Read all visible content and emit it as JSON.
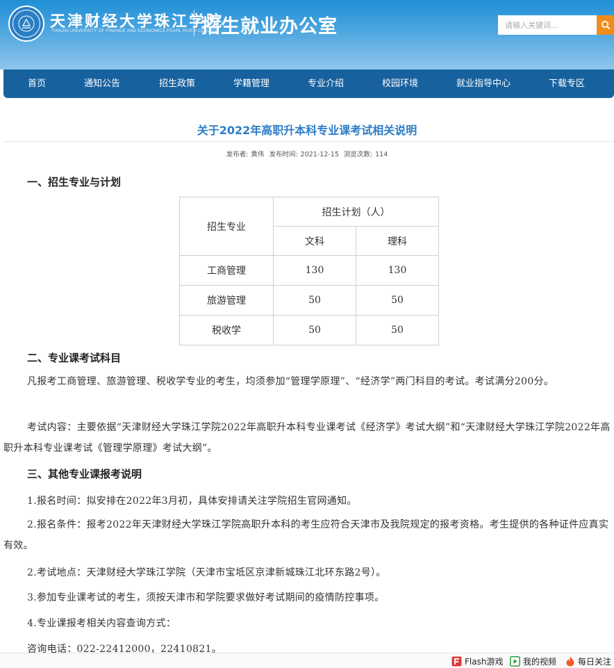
{
  "header": {
    "school_name_cn": "天津财经大学珠江学院",
    "school_name_en": "TIANJIN UNIVERSITY OF FINANCE AND ECONOMICS PEARL RIVER COLLEGE",
    "office_title": "招生就业办公室",
    "search": {
      "placeholder": "请输入关键词..."
    },
    "brand_color": "#1f8fd6",
    "search_button_color": "#f08c1c"
  },
  "nav": {
    "color": "#17619f",
    "items": [
      {
        "label": "首页"
      },
      {
        "label": "通知公告"
      },
      {
        "label": "招生政策"
      },
      {
        "label": "学籍管理"
      },
      {
        "label": "专业介绍"
      },
      {
        "label": "校园环境"
      },
      {
        "label": "就业指导中心"
      },
      {
        "label": "下载专区"
      }
    ]
  },
  "article": {
    "title": "关于2022年高职升本科专业课考试相关说明",
    "title_color": "#2c7cc7",
    "meta": {
      "author_label": "发布者:",
      "author": "黄伟",
      "time_label": "发布时间:",
      "time": "2021-12-15",
      "views_label": "浏览次数:",
      "views": "114"
    },
    "section1": {
      "heading": "一、招生专业与计划",
      "table": {
        "col_major": "招生专业",
        "col_plan": "招生计划（人）",
        "col_arts": "文科",
        "col_science": "理科",
        "rows": [
          {
            "major": "工商管理",
            "arts": "130",
            "science": "130"
          },
          {
            "major": "旅游管理",
            "arts": "50",
            "science": "50"
          },
          {
            "major": "税收学",
            "arts": "50",
            "science": "50"
          }
        ]
      }
    },
    "section2": {
      "heading": "二、专业课考试科目",
      "p1": "凡报考工商管理、旅游管理、税收学专业的考生，均须参加“管理学原理”、“经济学”两门科目的考试。考试满分200分。",
      "p2": "考试内容：主要依据“天津财经大学珠江学院2022年高职升本科专业课考试《经济学》考试大纲”和“天津财经大学珠江学院2022年高职升本科专业课考试《管理学原理》考试大纲”。"
    },
    "section3": {
      "heading": "三、其他专业课报考说明",
      "item1": "1.报名时间：拟安排在2022年3月初，具体安排请关注学院招生官网通知。",
      "item2": "2.报名条件：报考2022年天津财经大学珠江学院高职升本科的考生应符合天津市及我院规定的报考资格。考生提供的各种证件应真实有效。",
      "item3": "2.考试地点：天津财经大学珠江学院（天津市宝坻区京津新城珠江北环东路2号）。",
      "item4": "3.参加专业课考试的考生，须按天津市和学院要求做好考试期间的疫情防控事项。",
      "item5": "4.专业课报考相关内容查询方式：",
      "contact": "咨询电话：022-22412000，22410821。"
    }
  },
  "bottom_bar": {
    "items": [
      {
        "label": "Flash游戏",
        "icon": "flash-game-icon"
      },
      {
        "label": "我的视频",
        "icon": "video-play-icon"
      },
      {
        "label": "每日关注",
        "icon": "flame-icon"
      }
    ]
  }
}
